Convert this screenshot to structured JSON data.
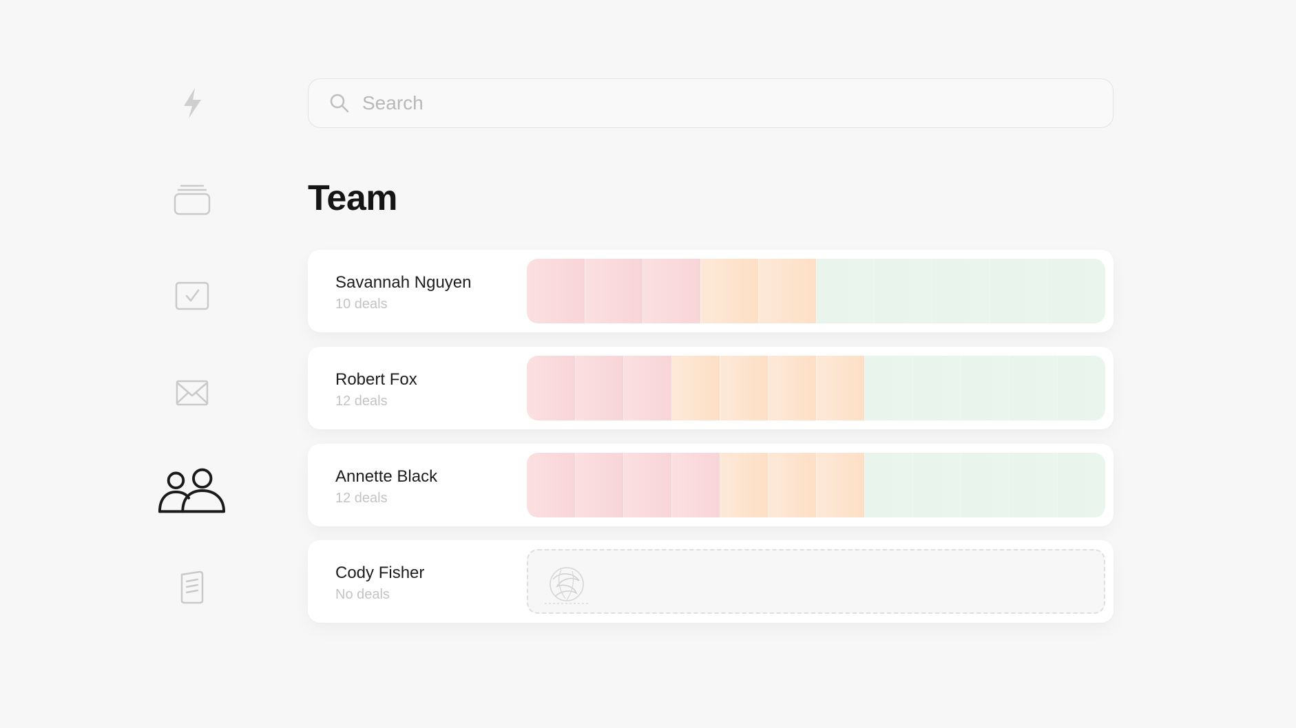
{
  "sidebar": {
    "items": [
      {
        "icon": "lightning-icon",
        "active": false
      },
      {
        "icon": "inbox-stack-icon",
        "active": false
      },
      {
        "icon": "task-check-icon",
        "active": false
      },
      {
        "icon": "mail-icon",
        "active": false
      },
      {
        "icon": "team-users-icon",
        "active": true
      },
      {
        "icon": "notes-icon",
        "active": false
      }
    ]
  },
  "search": {
    "placeholder": "Search",
    "value": ""
  },
  "page": {
    "title": "Team"
  },
  "colors": {
    "red_segment": "#f8d5d8",
    "orange_segment": "#fddfc5",
    "green_segment": "#e8f4ec",
    "active_icon": "#1a1a1a",
    "inactive_icon": "#c9c9c9"
  },
  "members": [
    {
      "name": "Savannah Nguyen",
      "deals_label": "10 deals",
      "deals": {
        "red": 3,
        "orange": 2,
        "green": 5
      }
    },
    {
      "name": "Robert Fox",
      "deals_label": "12 deals",
      "deals": {
        "red": 3,
        "orange": 4,
        "green": 5
      }
    },
    {
      "name": "Annette Black",
      "deals_label": "12 deals",
      "deals": {
        "red": 4,
        "orange": 3,
        "green": 5
      }
    },
    {
      "name": "Cody Fisher",
      "deals_label": "No deals",
      "deals": {
        "red": 0,
        "orange": 0,
        "green": 0
      }
    }
  ]
}
